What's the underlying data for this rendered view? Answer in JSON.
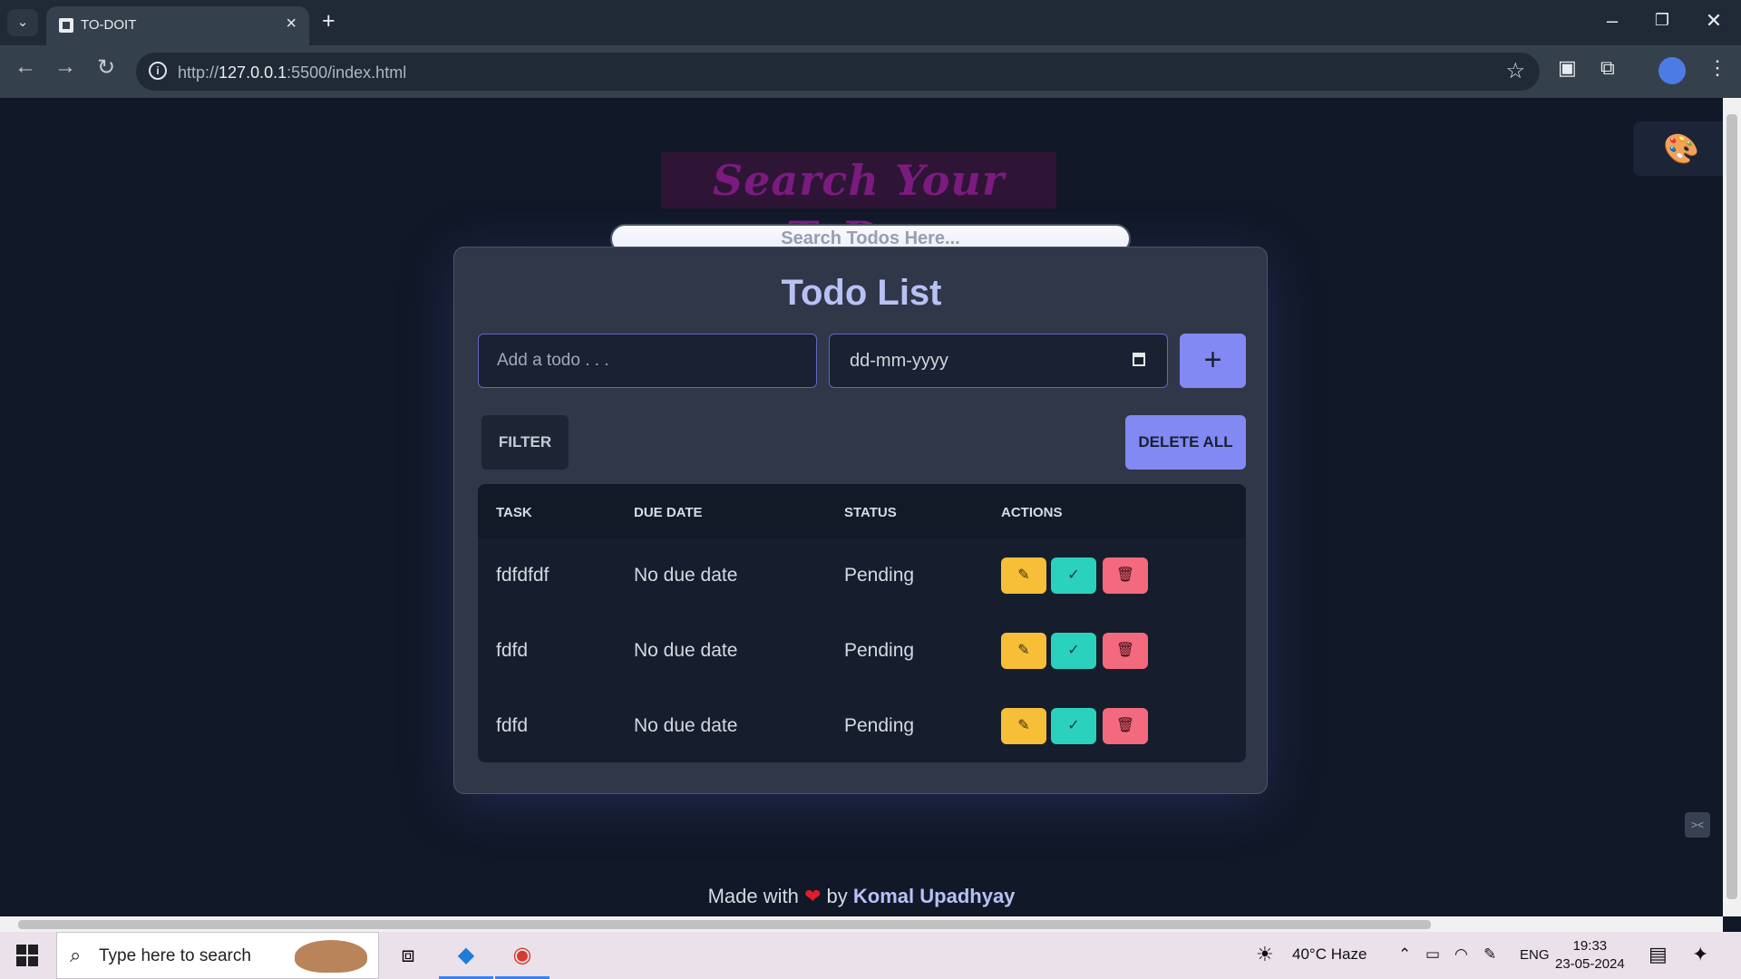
{
  "browser": {
    "tab_title": "TO-DOIT",
    "url_prefix": "http://",
    "url_host": "127.0.0.1",
    "url_rest": ":5500/index.html"
  },
  "app": {
    "heading": "Search Your ToDos",
    "search_placeholder": "Search Todos Here...",
    "card_title": "Todo List",
    "todo_placeholder": "Add a todo . . .",
    "date_placeholder": "dd-mm-yyyy",
    "add_label": "+",
    "filter_label": "FILTER",
    "delete_all_label": "DELETE ALL",
    "table": {
      "headers": [
        "TASK",
        "DUE DATE",
        "STATUS",
        "ACTIONS"
      ],
      "rows": [
        {
          "task": "fdfdfdf",
          "due": "No due date",
          "status": "Pending"
        },
        {
          "task": "fdfd",
          "due": "No due date",
          "status": "Pending"
        },
        {
          "task": "fdfd",
          "due": "No due date",
          "status": "Pending"
        }
      ]
    },
    "footer": {
      "prefix": "Made with",
      "by": "by",
      "author": "Komal Upadhyay"
    }
  },
  "taskbar": {
    "search_placeholder": "Type here to search",
    "weather": "40°C  Haze",
    "language": "ENG",
    "time": "19:33",
    "date": "23-05-2024"
  },
  "colors": {
    "accent": "#8289f2",
    "background": "#111827",
    "card": "#2f3748",
    "edit": "#f7be38",
    "done": "#2ad1bd",
    "delete": "#f3697d"
  }
}
